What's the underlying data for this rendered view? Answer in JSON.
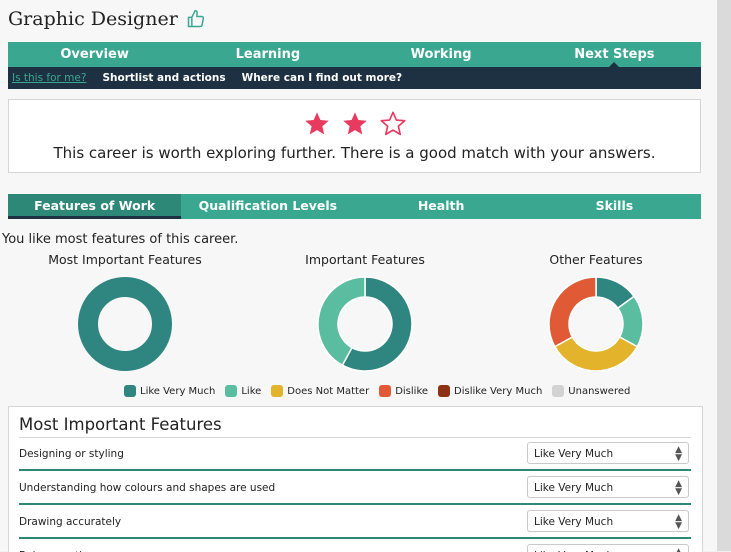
{
  "page": {
    "title": "Graphic Designer"
  },
  "main_nav": [
    {
      "label": "Overview"
    },
    {
      "label": "Learning"
    },
    {
      "label": "Working"
    },
    {
      "label": "Next Steps"
    }
  ],
  "sub_nav": [
    {
      "label": "Is this for me?"
    },
    {
      "label": "Shortlist and actions"
    },
    {
      "label": "Where can I find out more?"
    }
  ],
  "rating": {
    "stars_filled": 2,
    "stars_total": 3,
    "message": "This career is worth exploring further. There is a good match with your answers."
  },
  "feature_tabs": [
    {
      "label": "Features of Work"
    },
    {
      "label": "Qualification Levels"
    },
    {
      "label": "Health"
    },
    {
      "label": "Skills"
    }
  ],
  "summary_text": "You like most features of this career.",
  "colors": {
    "like_very_much": "#2f8580",
    "like": "#5bbd9f",
    "does_not_matter": "#e3b32b",
    "dislike": "#df5a35",
    "dislike_very_much": "#8e3216",
    "unanswered": "#d2d2d2",
    "nav_green": "#3aa891",
    "nav_dark": "#1d3142",
    "star": "#e8395f"
  },
  "chart_data": [
    {
      "type": "pie",
      "title": "Most Important Features",
      "categories": [
        "Like Very Much"
      ],
      "values": [
        100
      ]
    },
    {
      "type": "pie",
      "title": "Important Features",
      "categories": [
        "Like Very Much",
        "Like"
      ],
      "values": [
        58,
        42
      ]
    },
    {
      "type": "pie",
      "title": "Other Features",
      "categories": [
        "Like Very Much",
        "Like",
        "Does Not Matter",
        "Dislike"
      ],
      "values": [
        15,
        18,
        34,
        33
      ]
    }
  ],
  "legend": [
    {
      "label": "Like Very Much",
      "key": "like_very_much"
    },
    {
      "label": "Like",
      "key": "like"
    },
    {
      "label": "Does Not Matter",
      "key": "does_not_matter"
    },
    {
      "label": "Dislike",
      "key": "dislike"
    },
    {
      "label": "Dislike Very Much",
      "key": "dislike_very_much"
    },
    {
      "label": "Unanswered",
      "key": "unanswered"
    }
  ],
  "features_panel": {
    "heading": "Most Important Features",
    "rows": [
      {
        "label": "Designing or styling",
        "value": "Like Very Much"
      },
      {
        "label": "Understanding how colours and shapes are used",
        "value": "Like Very Much"
      },
      {
        "label": "Drawing accurately",
        "value": "Like Very Much"
      },
      {
        "label": "Being creative",
        "value": "Like Very Much"
      }
    ]
  }
}
